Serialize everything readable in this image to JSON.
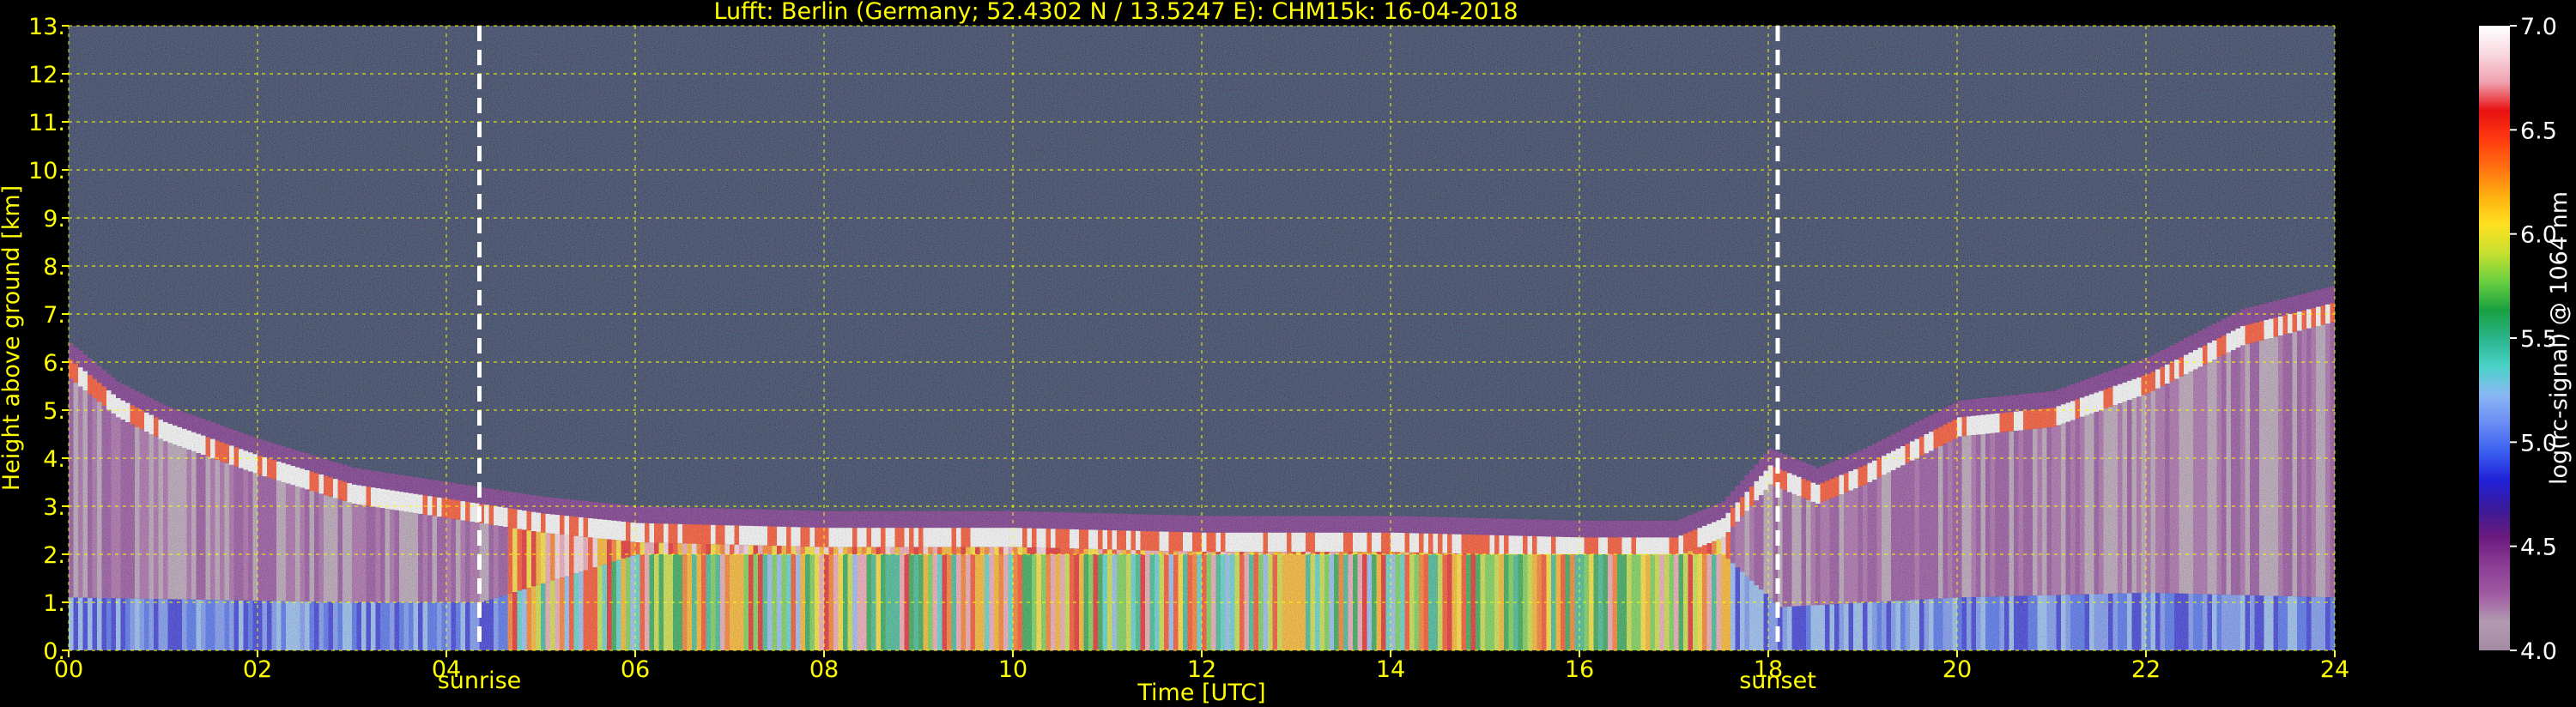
{
  "chart_data": {
    "type": "heatmap",
    "title": "Lufft: Berlin (Germany; 52.4302 N / 13.5247 E):    CHM15k: 16-04-2018",
    "xlabel": "Time [UTC]",
    "ylabel": "Height above ground [km]",
    "xlim": [
      0,
      24
    ],
    "ylim": [
      0,
      13
    ],
    "xticks": [
      "00",
      "02",
      "04",
      "06",
      "08",
      "10",
      "12",
      "14",
      "16",
      "18",
      "20",
      "22",
      "24"
    ],
    "yticks": [
      "0.",
      "1.",
      "2.",
      "3.",
      "4.",
      "5.",
      "6.",
      "7.",
      "8.",
      "9.",
      "10.",
      "11.",
      "12.",
      "13."
    ],
    "grid": true,
    "events": [
      {
        "label": "sunrise",
        "time": 4.35
      },
      {
        "label": "sunset",
        "time": 18.1
      }
    ],
    "colorbar": {
      "label": "log(rc-signal) @ 1064 nm",
      "range": [
        4.0,
        7.0
      ],
      "ticks": [
        "4.0",
        "4.5",
        "5.0",
        "5.5",
        "6.0",
        "6.5",
        "7.0"
      ]
    },
    "layers": [
      {
        "name": "boundary-layer-top",
        "points": [
          [
            0,
            5.8
          ],
          [
            0.5,
            5.0
          ],
          [
            1,
            4.5
          ],
          [
            2,
            3.8
          ],
          [
            3,
            3.2
          ],
          [
            4,
            2.9
          ],
          [
            5,
            2.6
          ],
          [
            6,
            2.4
          ],
          [
            8,
            2.3
          ],
          [
            10,
            2.3
          ],
          [
            12,
            2.2
          ],
          [
            14,
            2.2
          ],
          [
            16,
            2.1
          ],
          [
            17,
            2.1
          ],
          [
            17.5,
            2.5
          ],
          [
            18,
            3.6
          ],
          [
            18.5,
            3.2
          ],
          [
            19,
            3.6
          ],
          [
            20,
            4.6
          ],
          [
            21,
            4.8
          ],
          [
            22,
            5.5
          ],
          [
            23,
            6.5
          ],
          [
            24,
            7.0
          ]
        ]
      },
      {
        "name": "aerosol-layer-top",
        "points": [
          [
            0,
            1.1
          ],
          [
            3,
            1.0
          ],
          [
            4.35,
            1.0
          ],
          [
            6,
            2.0
          ],
          [
            10,
            2.0
          ],
          [
            17.5,
            2.0
          ],
          [
            18.1,
            0.9
          ],
          [
            20,
            1.1
          ],
          [
            22,
            1.2
          ],
          [
            24,
            1.1
          ]
        ]
      }
    ]
  },
  "colors": {
    "text": "#ffff00",
    "grid": "#ffff00",
    "event_line": "#ffffff",
    "background": "#000000",
    "colormap": [
      "#a58aa3",
      "#b29ab1",
      "#a05aa2",
      "#8a3c94",
      "#6a1a7e",
      "#3a1a9a",
      "#2020d8",
      "#3a60f0",
      "#6a8cf4",
      "#8ab8f4",
      "#4ad2c8",
      "#2ab48a",
      "#1aa040",
      "#6ad040",
      "#c8e030",
      "#ffe020",
      "#ffb010",
      "#ff7010",
      "#ff3a10",
      "#e81010",
      "#f0a0b0",
      "#f8d8e0",
      "#ffffff"
    ]
  }
}
